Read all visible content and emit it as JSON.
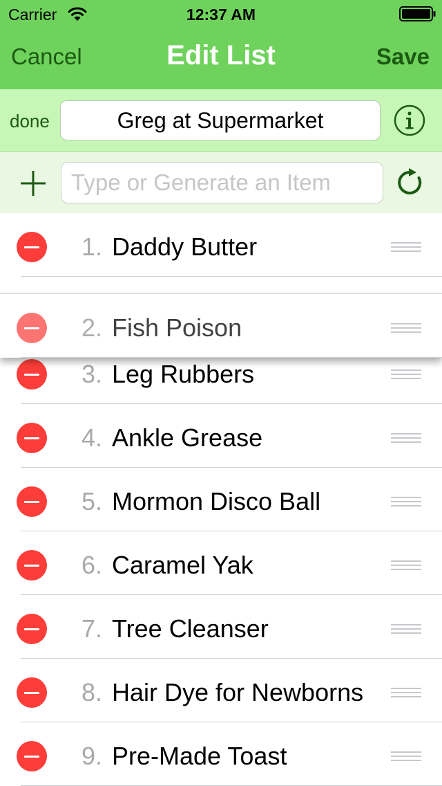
{
  "status_bar": {
    "carrier": "Carrier",
    "time": "12:37 AM",
    "wifi_icon": "wifi-icon",
    "battery_icon": "battery-icon"
  },
  "nav": {
    "cancel_label": "Cancel",
    "title": "Edit List",
    "save_label": "Save"
  },
  "list_name": {
    "done_label": "done",
    "value": "Greg at Supermarket",
    "info_icon": "info-icon"
  },
  "add_item": {
    "add_icon": "plus-icon",
    "placeholder": "Type or Generate an Item",
    "value": "",
    "generate_icon": "refresh-icon"
  },
  "items": [
    {
      "number": "1.",
      "name": "Daddy Butter",
      "dragging": false
    },
    {
      "number": "2.",
      "name": "Fish Poison",
      "dragging": true
    },
    {
      "number": "3.",
      "name": "Leg Rubbers",
      "dragging": false
    },
    {
      "number": "4.",
      "name": "Ankle Grease",
      "dragging": false
    },
    {
      "number": "5.",
      "name": "Mormon Disco Ball",
      "dragging": false
    },
    {
      "number": "6.",
      "name": "Caramel Yak",
      "dragging": false
    },
    {
      "number": "7.",
      "name": "Tree Cleanser",
      "dragging": false
    },
    {
      "number": "8.",
      "name": "Hair Dye for Newborns",
      "dragging": false
    },
    {
      "number": "9.",
      "name": "Pre-Made Toast",
      "dragging": false
    }
  ],
  "colors": {
    "nav_background": "#6fd25c",
    "name_row_background": "#c7f7b6",
    "add_row_background": "#e9f7e3",
    "accent_dark_green": "#1c5a12",
    "delete_red": "#fc3d39"
  }
}
